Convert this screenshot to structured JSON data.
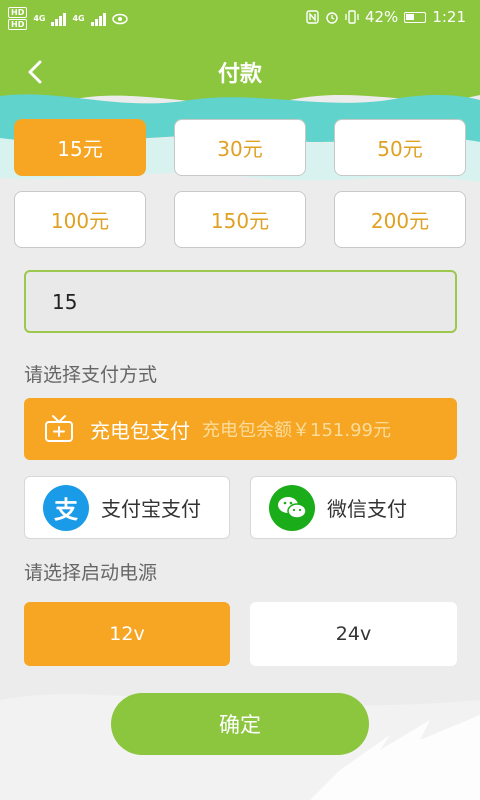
{
  "status_bar": {
    "hd_top": "HD",
    "hd_bottom": "HD",
    "network_1": "4G",
    "network_2": "4G",
    "battery": "42%",
    "time": "1:21"
  },
  "header": {
    "title": "付款"
  },
  "amounts": [
    {
      "label": "15元",
      "selected": true
    },
    {
      "label": "30元",
      "selected": false
    },
    {
      "label": "50元",
      "selected": false
    },
    {
      "label": "100元",
      "selected": false
    },
    {
      "label": "150元",
      "selected": false
    },
    {
      "label": "200元",
      "selected": false
    }
  ],
  "amount_input": {
    "value": "15"
  },
  "payment": {
    "label": "请选择支付方式",
    "charge_pack": {
      "label": "充电包支付",
      "balance": "充电包余额￥151.99元"
    },
    "alipay": {
      "label": "支付宝支付",
      "icon_char": "支"
    },
    "wechat": {
      "label": "微信支付"
    }
  },
  "power": {
    "label": "请选择启动电源",
    "options": [
      {
        "label": "12v",
        "selected": true
      },
      {
        "label": "24v",
        "selected": false
      }
    ]
  },
  "confirm_label": "确定",
  "colors": {
    "accent_orange": "#f6a623",
    "brand_green": "#8cc63f",
    "alipay_blue": "#1a9be8",
    "wechat_green": "#1aad19"
  }
}
